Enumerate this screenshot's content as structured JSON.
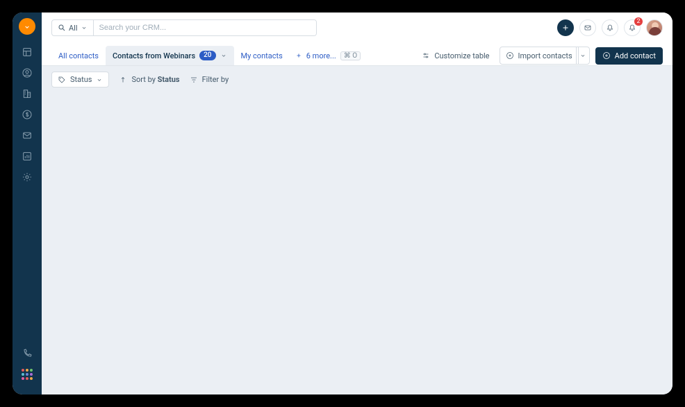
{
  "search": {
    "scope_label": "All",
    "placeholder": "Search your CRM..."
  },
  "header": {
    "notifications_count": "2"
  },
  "tabs": {
    "all_contacts": "All contacts",
    "current": {
      "label": "Contacts from Webinars",
      "count": "20"
    },
    "my_contacts": "My contacts",
    "more_label": "6 more...",
    "kbd_hint": "O"
  },
  "actions": {
    "customize_table": "Customize table",
    "import_contacts": "Import contacts",
    "add_contact": "Add contact"
  },
  "toolbar": {
    "status_chip": "Status",
    "sort_prefix": "Sort by ",
    "sort_field": "Status",
    "filter_by": "Filter by"
  }
}
